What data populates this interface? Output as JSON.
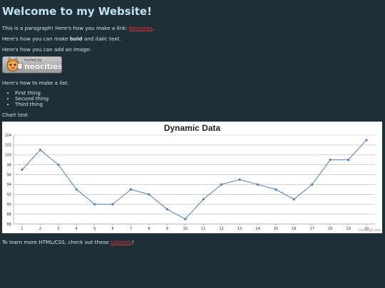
{
  "page": {
    "heading": "Welcome to my Website!",
    "p1_prefix": "This is a paragraph! Here's how you make a link: ",
    "p1_link": "Neocities",
    "p1_suffix": ".",
    "p2_prefix": "Here's how you can make ",
    "p2_bold": "bold",
    "p2_mid": " and ",
    "p2_italic": "italic",
    "p2_suffix": " text.",
    "p3": "Here's how you can add an image:",
    "badge_small": "hosted by",
    "badge_brand": "neocities",
    "p4": "Here's how to make a list:",
    "list": [
      "First thing",
      "Second thing",
      "Third thing"
    ],
    "chart_caption": "Chart test",
    "footer_prefix": "To learn more HTML/CSS, check out these ",
    "footer_link": "tutorials",
    "footer_suffix": "!",
    "chart_credit": "CanvasJS.com"
  },
  "colors": {
    "background": "#1e2f38",
    "text": "#d6e3ea",
    "heading": "#bfe0f0",
    "link": "#e0303a",
    "series_line": "#4a7fb8"
  },
  "chart_data": {
    "type": "line",
    "title": "Dynamic Data",
    "x": [
      1,
      2,
      3,
      4,
      5,
      6,
      7,
      8,
      9,
      10,
      11,
      12,
      13,
      14,
      15,
      16,
      17,
      18,
      19,
      20
    ],
    "values": [
      97,
      101,
      98,
      93,
      90,
      90,
      93,
      92,
      89,
      87,
      91,
      94,
      95,
      94,
      93,
      91,
      94,
      99,
      99,
      103
    ],
    "ylim": [
      86,
      104
    ],
    "yticks": [
      86,
      88,
      90,
      92,
      94,
      96,
      98,
      100,
      102,
      104
    ],
    "grid": true,
    "xlabel": "",
    "ylabel": ""
  }
}
